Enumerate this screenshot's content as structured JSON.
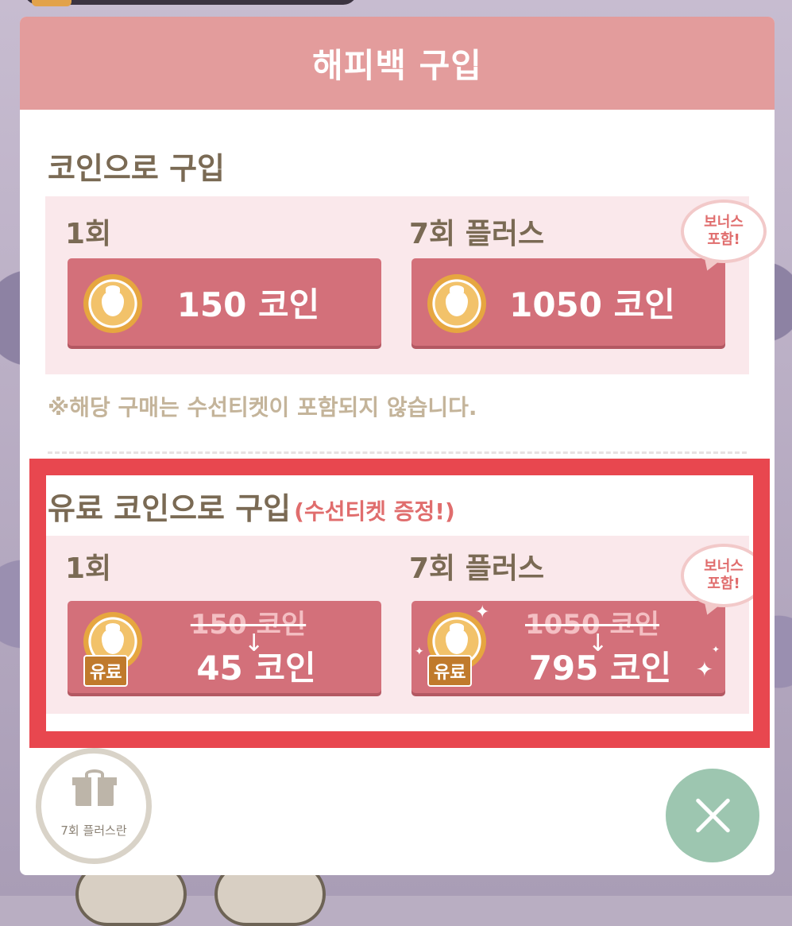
{
  "modal": {
    "title": "해피백 구입"
  },
  "coin_section": {
    "title": "코인으로 구입",
    "options": [
      {
        "label": "1회",
        "price": "150 코인"
      },
      {
        "label": "7회 플러스",
        "price": "1050 코인"
      }
    ],
    "bonus_line1": "보너스",
    "bonus_line2": "포함!",
    "notice": "※해당 구매는 수선티켓이 포함되지 않습니다."
  },
  "paid_section": {
    "title": "유료 코인으로 구입",
    "subtitle": "(수선티켓 증정!)",
    "paid_tag": "유료",
    "options": [
      {
        "label": "1회",
        "old_price": "150 코인",
        "new_price": "45 코인"
      },
      {
        "label": "7회 플러스",
        "old_price": "1050 코인",
        "new_price": "795 코인"
      }
    ],
    "bonus_line1": "보너스",
    "bonus_line2": "포함!"
  },
  "gift_button": {
    "label": "7회 플러스란"
  },
  "colors": {
    "header": "#e39c9c",
    "button": "#d3707a",
    "highlight": "#e8474f",
    "close": "#9dc6b0"
  },
  "icons": {
    "coin": "strawberry-coin-icon",
    "gift": "gift-icon",
    "close": "close-icon"
  }
}
